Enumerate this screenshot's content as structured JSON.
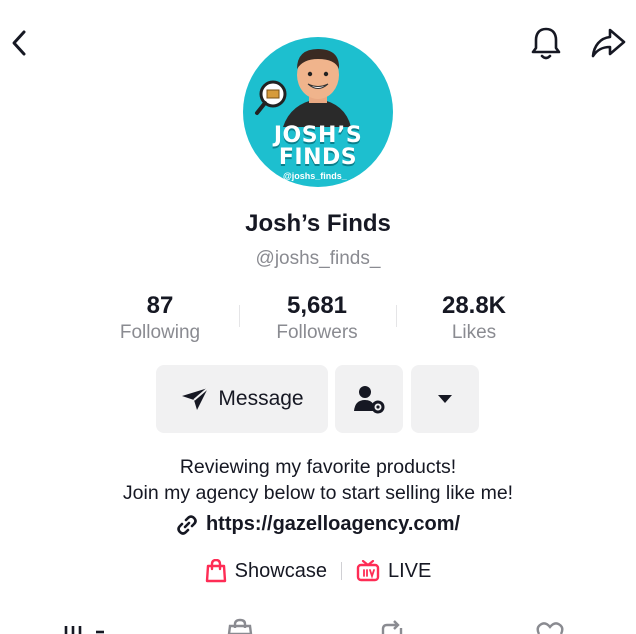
{
  "profile": {
    "avatar_brand_line1": "JOSH’S",
    "avatar_brand_line2": "FINDS",
    "avatar_handle": "@joshs_finds_",
    "name": "Josh’s Finds",
    "handle": "@joshs_finds_"
  },
  "stats": [
    {
      "value": "87",
      "label": "Following"
    },
    {
      "value": "5,681",
      "label": "Followers"
    },
    {
      "value": "28.8K",
      "label": "Likes"
    }
  ],
  "actions": {
    "message_label": "Message"
  },
  "bio": {
    "line1": "Reviewing my favorite products!",
    "line2": "Join my agency below to start selling like me!",
    "link": "https://gazelloagency.com/"
  },
  "badges": {
    "showcase": "Showcase",
    "live": "LIVE"
  },
  "colors": {
    "text": "#161823",
    "secondary": "#8a8b91",
    "button_bg": "#f1f1f2",
    "accent_red": "#fe2c55",
    "avatar_bg": "#1dbfcf"
  }
}
